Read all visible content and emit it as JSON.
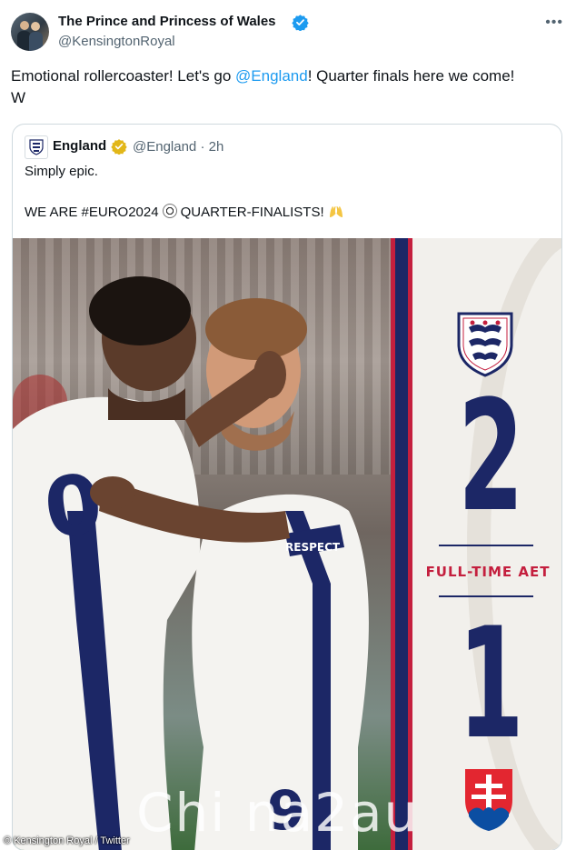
{
  "author": {
    "display_name": "The Prince and Princess of Wales",
    "handle": "@KensingtonRoyal"
  },
  "tweet": {
    "text_before": "Emotional rollercoaster! Let's go ",
    "mention": "@England",
    "text_after": "! Quarter finals here we come!",
    "signature": "W"
  },
  "quoted_tweet": {
    "display_name": "England",
    "handle_time": "@England · 2h",
    "line1": "Simply epic.",
    "line2": "WE ARE #EURO2024",
    "line2_tail": "QUARTER-FINALISTS!"
  },
  "scoreboard": {
    "home_score": "2",
    "away_score": "1",
    "status": "FULL-TIME AET"
  },
  "overlay": {
    "credit": "© Kensington Royal / Twitter",
    "watermark": "Chi na2au"
  },
  "colors": {
    "accent": "#1d9bf0",
    "verified": "#1d9bf0",
    "england_navy": "#1c2766",
    "england_red": "#c41f3e",
    "gold_badge": "#e2b719"
  }
}
